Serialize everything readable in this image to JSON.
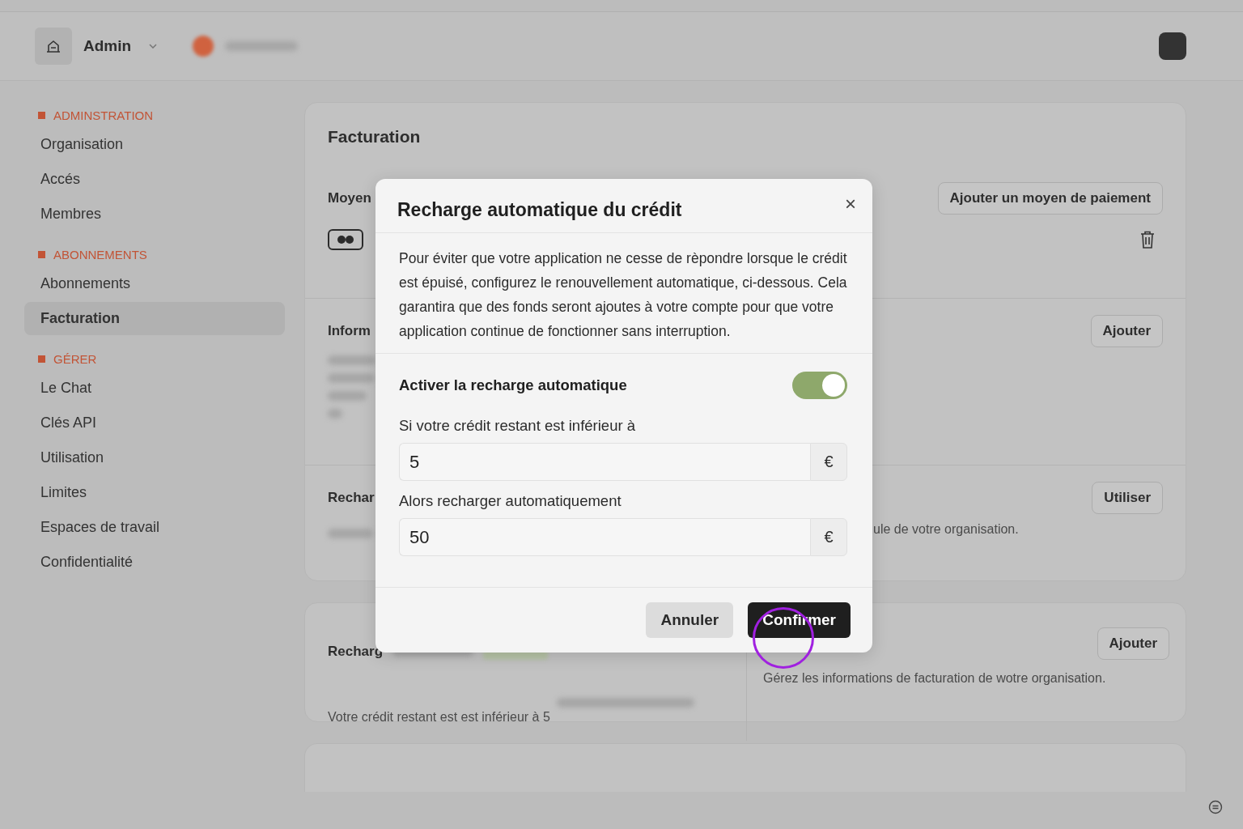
{
  "topbar": {
    "workspace": "Admin"
  },
  "sidebar": {
    "sections": [
      {
        "title": "ADMINSTRATION",
        "items": [
          {
            "label": "Organisation",
            "selected": false
          },
          {
            "label": "Accés",
            "selected": false
          },
          {
            "label": "Membres",
            "selected": false
          }
        ]
      },
      {
        "title": "ABONNEMENTS",
        "items": [
          {
            "label": "Abonnements",
            "selected": false
          },
          {
            "label": "Facturation",
            "selected": true
          }
        ]
      },
      {
        "title": "GÉRER",
        "items": [
          {
            "label": "Le Chat",
            "selected": false
          },
          {
            "label": "Clés API",
            "selected": false
          },
          {
            "label": "Utilisation",
            "selected": false
          },
          {
            "label": "Limites",
            "selected": false
          },
          {
            "label": "Espaces de travail",
            "selected": false
          },
          {
            "label": "Confidentialité",
            "selected": false
          }
        ]
      }
    ]
  },
  "page": {
    "title": "Facturation",
    "sections": [
      {
        "kind": "payment",
        "title": "Moyen",
        "button": "Ajouter un moyen de paiement"
      },
      {
        "kind": "info",
        "title": "Inform",
        "button": "Ajouter"
      },
      {
        "kind": "recharge",
        "title": "Rechar",
        "button": "Utiliser",
        "text": "ule de votre organisation."
      }
    ],
    "auto_card": {
      "title": "Recharg",
      "text": "Votre crédit restant est est inférieur à 5",
      "button": "Ajouter",
      "right_text": "Gérez les informations de facturation de wotre organisation."
    }
  },
  "dialog": {
    "title": "Recharge automatique du crédit",
    "close": "×",
    "text": "Pour éviter que votre application ne cesse de rèpondre lorsque le crédit est épuisé, configurez le renouvellement automatique, ci-dessous. Cela garantira que des fonds seront ajoutes à votre compte pour que votre application continue de fonctionner sans interruption.",
    "auto": {
      "label": "Activer la recharge automatique",
      "on": true
    },
    "fields": [
      {
        "label": "Si votre crédit restant est inférieur à",
        "value": "5",
        "unit": "€"
      },
      {
        "label": "Alors recharger automatiquement",
        "value": "50",
        "unit": "€"
      }
    ],
    "buttons": [
      {
        "kind": "secondary",
        "label": "Annuler"
      },
      {
        "kind": "primary",
        "label": "Confirmer"
      }
    ]
  }
}
